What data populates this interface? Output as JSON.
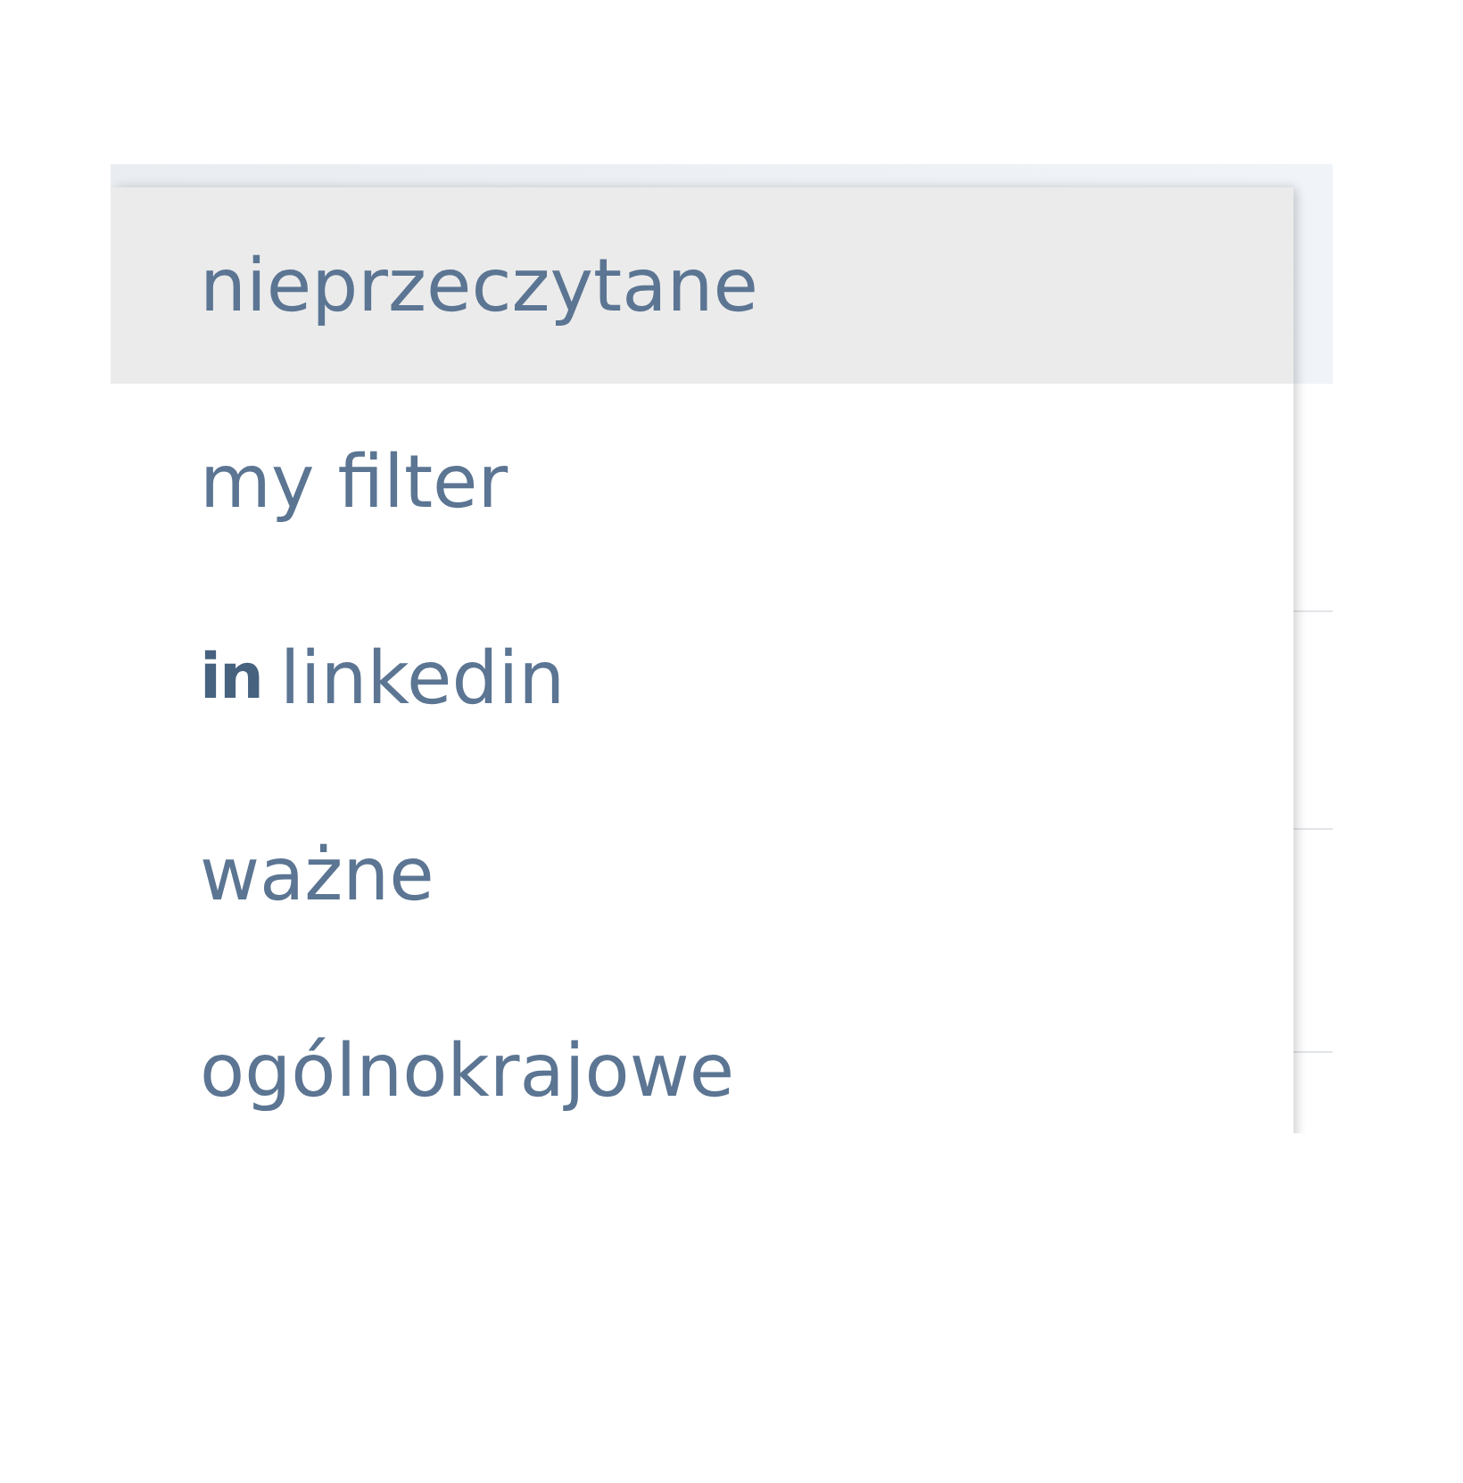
{
  "filter_menu": {
    "items": [
      {
        "label": "nieprzeczytane",
        "selected": true
      },
      {
        "label": "my filter",
        "selected": false
      },
      {
        "label": "linkedin",
        "icon": "in",
        "selected": false
      },
      {
        "label": "ważne",
        "selected": false
      },
      {
        "label": "ogólnokrajowe",
        "selected": false
      }
    ]
  }
}
